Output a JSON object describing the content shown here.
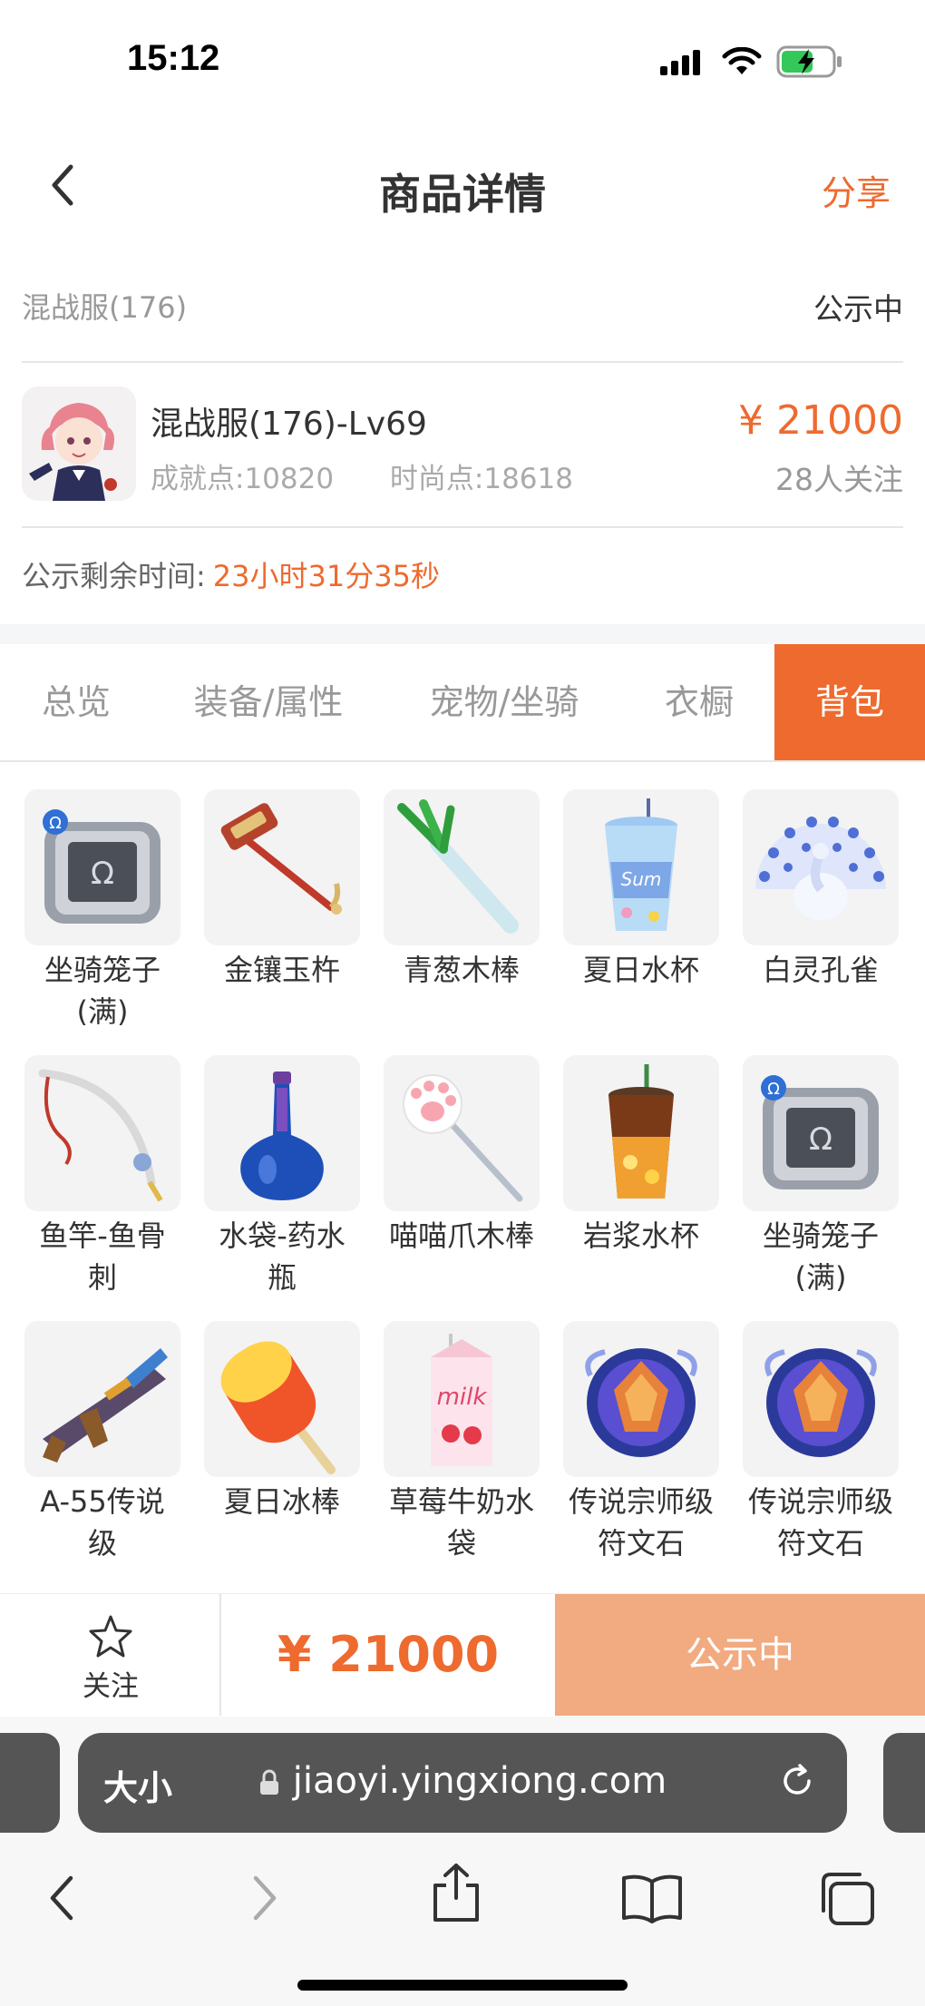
{
  "status_bar": {
    "time": "15:12"
  },
  "nav": {
    "title": "商品详情",
    "share": "分享"
  },
  "server": {
    "name": "混战服(176)",
    "status": "公示中"
  },
  "product": {
    "title": "混战服(176)-Lv69",
    "achievement": "成就点:10820",
    "fashion": "时尚点:18618",
    "price": "¥ 21000",
    "followers": "28人关注"
  },
  "remaining": {
    "label": "公示剩余时间:",
    "value": "23小时31分35秒"
  },
  "tabs": [
    {
      "label": "总览"
    },
    {
      "label": "装备/属性"
    },
    {
      "label": "宠物/坐骑"
    },
    {
      "label": "衣橱"
    },
    {
      "label": "背包"
    }
  ],
  "items": [
    {
      "line1": "坐骑笼子",
      "line2": "(满)",
      "icon": "mount-cage-icon"
    },
    {
      "line1": "金镶玉杵",
      "line2": "",
      "icon": "hammer-icon"
    },
    {
      "line1": "青葱木棒",
      "line2": "",
      "icon": "leek-icon"
    },
    {
      "line1": "夏日水杯",
      "line2": "",
      "icon": "summer-cup-icon"
    },
    {
      "line1": "白灵孔雀",
      "line2": "",
      "icon": "peacock-icon"
    },
    {
      "line1": "鱼竿-鱼骨",
      "line2": "刺",
      "icon": "fishing-rod-icon"
    },
    {
      "line1": "水袋-药水",
      "line2": "瓶",
      "icon": "potion-bottle-icon"
    },
    {
      "line1": "喵喵爪木棒",
      "line2": "",
      "icon": "paw-wand-icon"
    },
    {
      "line1": "岩浆水杯",
      "line2": "",
      "icon": "lava-cup-icon"
    },
    {
      "line1": "坐骑笼子",
      "line2": "(满)",
      "icon": "mount-cage-icon"
    },
    {
      "line1": "A-55传说",
      "line2": "级",
      "icon": "gun-icon"
    },
    {
      "line1": "夏日冰棒",
      "line2": "",
      "icon": "popsicle-icon"
    },
    {
      "line1": "草莓牛奶水",
      "line2": "袋",
      "icon": "milk-carton-icon"
    },
    {
      "line1": "传说宗师级",
      "line2": "符文石",
      "icon": "rune-stone-icon"
    },
    {
      "line1": "传说宗师级",
      "line2": "符文石",
      "icon": "rune-stone-icon"
    }
  ],
  "bottom_bar": {
    "follow": "关注",
    "price": "¥ 21000",
    "status": "公示中"
  },
  "browser": {
    "aa": "大小",
    "url": "jiaoyi.yingxiong.com"
  },
  "colors": {
    "accent": "#ee6a2e",
    "accent_light": "#f2aa80"
  }
}
